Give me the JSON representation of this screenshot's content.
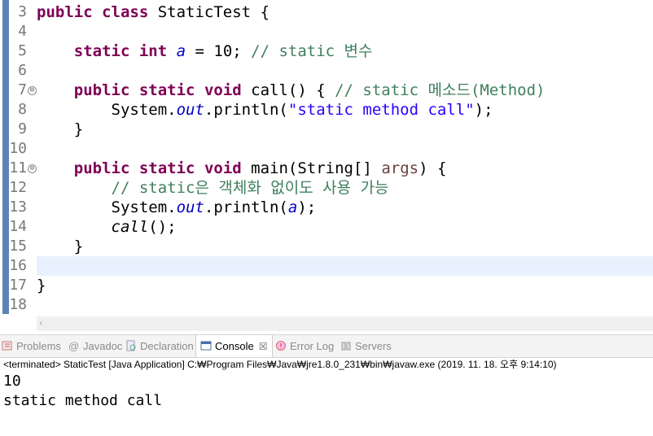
{
  "editor": {
    "line_numbers": [
      "3",
      "4",
      "5",
      "6",
      "7",
      "8",
      "9",
      "10",
      "11",
      "12",
      "13",
      "14",
      "15",
      "16",
      "17",
      "18"
    ],
    "lines": [
      [
        {
          "c": "kw",
          "t": "public"
        },
        {
          "c": "",
          "t": " "
        },
        {
          "c": "kw",
          "t": "class"
        },
        {
          "c": "",
          "t": " StaticTest {"
        }
      ],
      [],
      [
        {
          "c": "",
          "t": "    "
        },
        {
          "c": "kw",
          "t": "static"
        },
        {
          "c": "",
          "t": " "
        },
        {
          "c": "kw",
          "t": "int"
        },
        {
          "c": "",
          "t": " "
        },
        {
          "c": "fd",
          "t": "a"
        },
        {
          "c": "",
          "t": " = 10; "
        },
        {
          "c": "cm",
          "t": "// static 변수"
        }
      ],
      [],
      [
        {
          "c": "",
          "t": "    "
        },
        {
          "c": "kw",
          "t": "public"
        },
        {
          "c": "",
          "t": " "
        },
        {
          "c": "kw",
          "t": "static"
        },
        {
          "c": "",
          "t": " "
        },
        {
          "c": "kw",
          "t": "void"
        },
        {
          "c": "",
          "t": " call() { "
        },
        {
          "c": "cm",
          "t": "// static 메소드(Method)"
        }
      ],
      [
        {
          "c": "",
          "t": "        System."
        },
        {
          "c": "fi",
          "t": "out"
        },
        {
          "c": "",
          "t": ".println("
        },
        {
          "c": "st",
          "t": "\"static method call\""
        },
        {
          "c": "",
          "t": ");"
        }
      ],
      [
        {
          "c": "",
          "t": "    }"
        }
      ],
      [],
      [
        {
          "c": "",
          "t": "    "
        },
        {
          "c": "kw",
          "t": "public"
        },
        {
          "c": "",
          "t": " "
        },
        {
          "c": "kw",
          "t": "static"
        },
        {
          "c": "",
          "t": " "
        },
        {
          "c": "kw",
          "t": "void"
        },
        {
          "c": "",
          "t": " main(String[] "
        },
        {
          "c": "pv",
          "t": "args"
        },
        {
          "c": "",
          "t": ") {"
        }
      ],
      [
        {
          "c": "",
          "t": "        "
        },
        {
          "c": "cm",
          "t": "// static은 객체화 없이도 사용 가능"
        }
      ],
      [
        {
          "c": "",
          "t": "        System."
        },
        {
          "c": "fi",
          "t": "out"
        },
        {
          "c": "",
          "t": ".println("
        },
        {
          "c": "fd",
          "t": "a"
        },
        {
          "c": "",
          "t": ");"
        }
      ],
      [
        {
          "c": "",
          "t": "        "
        },
        {
          "c": "mi",
          "t": "call"
        },
        {
          "c": "",
          "t": "();"
        }
      ],
      [
        {
          "c": "",
          "t": "    }"
        }
      ],
      [],
      [
        {
          "c": "",
          "t": "}"
        }
      ],
      []
    ],
    "fold_markers": [
      "⊖",
      "⊖"
    ],
    "scroll_arrow": "‹"
  },
  "views": {
    "tabs": [
      {
        "label": "Problems",
        "icon": "problems-icon",
        "active": false
      },
      {
        "label": "Javadoc",
        "icon": "javadoc-icon",
        "active": false
      },
      {
        "label": "Declaration",
        "icon": "declaration-icon",
        "active": false
      },
      {
        "label": "Console",
        "icon": "console-icon",
        "active": true
      },
      {
        "label": "Error Log",
        "icon": "error-log-icon",
        "active": false
      },
      {
        "label": "Servers",
        "icon": "servers-icon",
        "active": false
      }
    ],
    "close_glyph": "☒"
  },
  "console": {
    "header": "<terminated> StaticTest [Java Application] C:₩Program Files₩Java₩jre1.8.0_231₩bin₩javaw.exe (2019. 11. 18. 오후 9:14:10)",
    "output": [
      "10",
      "static method call"
    ]
  },
  "colors": {
    "keyword": "#7f0055",
    "comment": "#3f7f5f",
    "string": "#2a00ff",
    "field": "#0000c0",
    "param": "#6a3e3e",
    "current_line": "#e8f2fe",
    "change_bar": "#5d84b9"
  }
}
